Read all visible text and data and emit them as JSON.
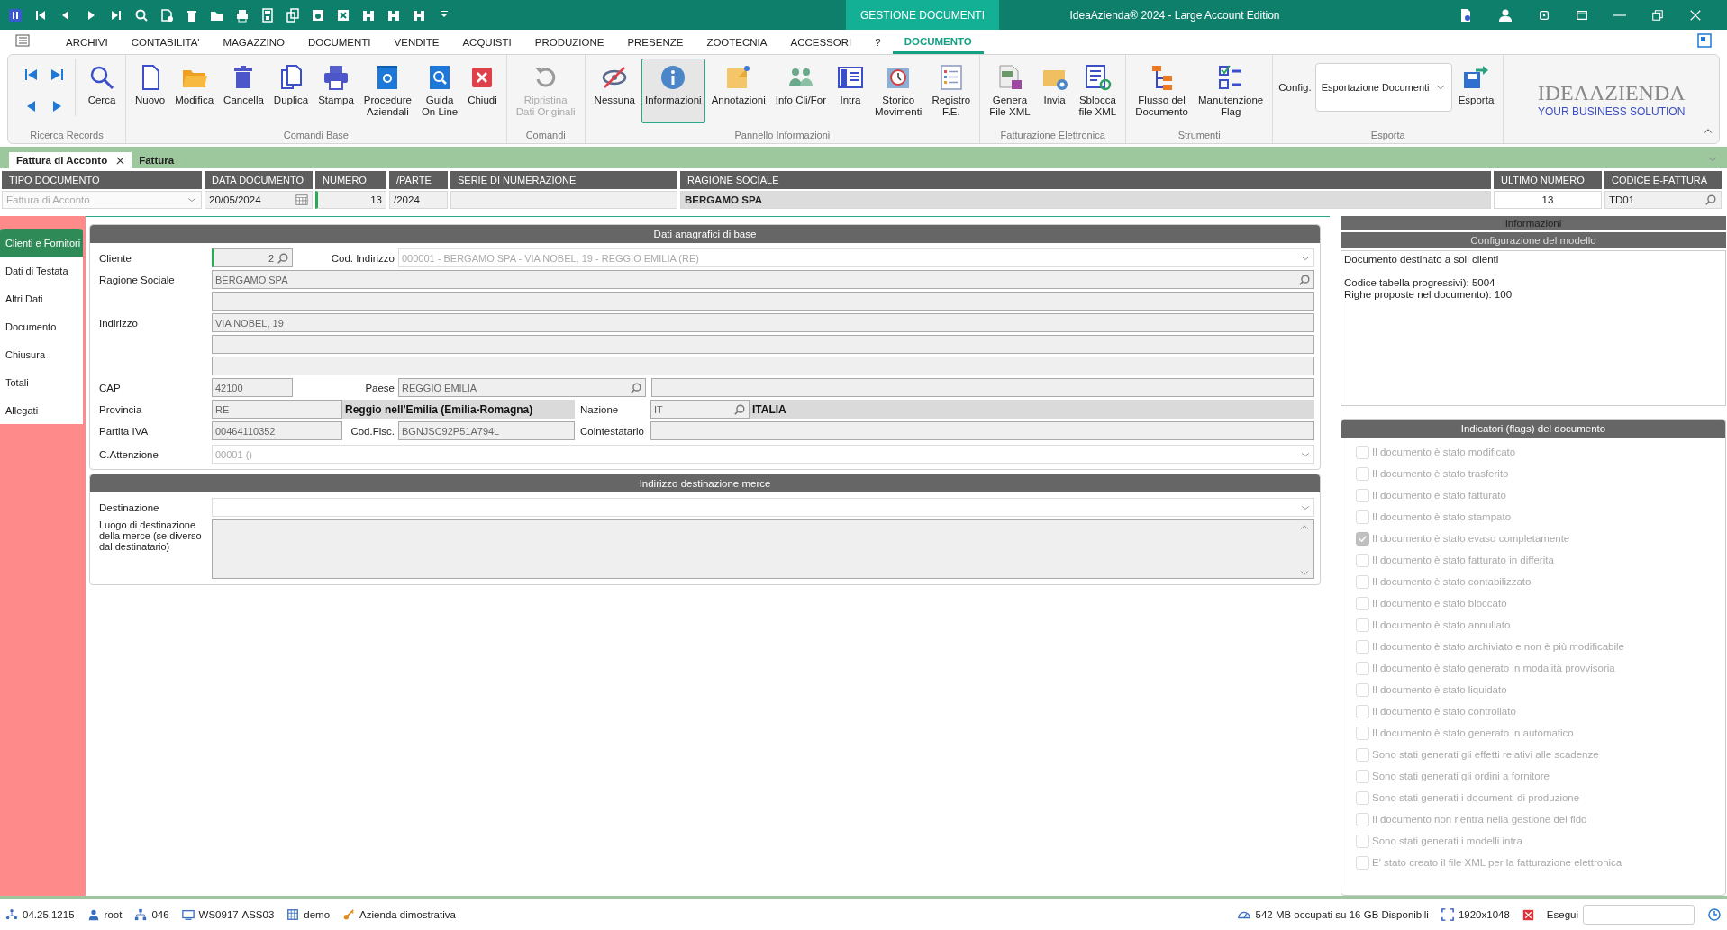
{
  "title_bar": {
    "module": "GESTIONE DOCUMENTI",
    "title": "IdeaAzienda® 2024 - Large Account Edition"
  },
  "menu": [
    {
      "label": "ARCHIVI",
      "selected": false
    },
    {
      "label": "CONTABILITA'",
      "selected": false
    },
    {
      "label": "MAGAZZINO",
      "selected": false
    },
    {
      "label": "DOCUMENTI",
      "selected": false
    },
    {
      "label": "VENDITE",
      "selected": false
    },
    {
      "label": "ACQUISTI",
      "selected": false
    },
    {
      "label": "PRODUZIONE",
      "selected": false
    },
    {
      "label": "PRESENZE",
      "selected": false
    },
    {
      "label": "ZOOTECNIA",
      "selected": false
    },
    {
      "label": "ACCESSORI",
      "selected": false
    },
    {
      "label": "?",
      "selected": false
    },
    {
      "label": "DOCUMENTO",
      "selected": true
    }
  ],
  "ribbon": {
    "groups": [
      {
        "label": "Ricerca Records",
        "buttons": [
          {
            "label": "Cerca",
            "selected": false,
            "disabled": false
          }
        ]
      },
      {
        "label": "Comandi Base",
        "buttons": [
          {
            "label": "Nuovo",
            "selected": false,
            "disabled": false
          },
          {
            "label": "Modifica",
            "selected": false,
            "disabled": false
          },
          {
            "label": "Cancella",
            "selected": false,
            "disabled": false
          },
          {
            "label": "Duplica",
            "selected": false,
            "disabled": false
          },
          {
            "label": "Stampa",
            "selected": false,
            "disabled": false
          },
          {
            "label": "Procedure\nAziendali",
            "selected": false,
            "disabled": false
          },
          {
            "label": "Guida\nOn Line",
            "selected": false,
            "disabled": false
          },
          {
            "label": "Chiudi",
            "selected": false,
            "disabled": false
          }
        ]
      },
      {
        "label": "Comandi",
        "buttons": [
          {
            "label": "Ripristina\nDati Originali",
            "selected": false,
            "disabled": true
          }
        ]
      },
      {
        "label": "Pannello Informazioni",
        "buttons": [
          {
            "label": "Nessuna",
            "selected": false,
            "disabled": false
          },
          {
            "label": "Informazioni",
            "selected": true,
            "disabled": false
          },
          {
            "label": "Annotazioni",
            "selected": false,
            "disabled": false
          },
          {
            "label": "Info Cli/For",
            "selected": false,
            "disabled": false
          },
          {
            "label": "Intra",
            "selected": false,
            "disabled": false
          },
          {
            "label": "Storico\nMovimenti",
            "selected": false,
            "disabled": false
          },
          {
            "label": "Registro\nF.E.",
            "selected": false,
            "disabled": false
          }
        ]
      },
      {
        "label": "Fatturazione Elettronica",
        "buttons": [
          {
            "label": "Genera\nFile XML",
            "selected": false,
            "disabled": false
          },
          {
            "label": "Invia",
            "selected": false,
            "disabled": false
          },
          {
            "label": "Sblocca\nfile XML",
            "selected": false,
            "disabled": false
          }
        ]
      },
      {
        "label": "Strumenti",
        "buttons": [
          {
            "label": "Flusso del\nDocumento",
            "selected": false,
            "disabled": false
          },
          {
            "label": "Manutenzione\nFlag",
            "selected": false,
            "disabled": false
          }
        ]
      },
      {
        "label": "Esporta",
        "config_label": "Config.",
        "config_value": "Esportazione Documenti",
        "buttons": [
          {
            "label": "Esporta",
            "selected": false,
            "disabled": false
          }
        ]
      }
    ]
  },
  "logo": {
    "name": "IDEAAZIENDA",
    "tagline": "YOUR BUSINESS SOLUTION"
  },
  "document_tabs": [
    {
      "label": "Fattura di Acconto",
      "selected": true
    },
    {
      "label": "Fattura",
      "selected": false
    }
  ],
  "header": [
    {
      "kind": "dropdown",
      "label": "TIPO DOCUMENTO",
      "value": "Fattura di Acconto"
    },
    {
      "kind": "date",
      "label": "DATA DOCUMENTO",
      "value": "20/05/2024"
    },
    {
      "kind": "number",
      "label": "NUMERO",
      "value": "13"
    },
    {
      "kind": "text",
      "label": "/PARTE",
      "value": "/2024"
    },
    {
      "kind": "text",
      "label": "SERIE DI NUMERAZIONE"
    },
    {
      "kind": "bold",
      "label": "RAGIONE SOCIALE",
      "value": "BERGAMO SPA"
    },
    {
      "kind": "center",
      "label": "ULTIMO NUMERO",
      "value": "13"
    },
    {
      "kind": "search",
      "label": "CODICE E-FATTURA",
      "value": "TD01"
    }
  ],
  "sidebar": [
    {
      "label": "Clienti e Fornitori",
      "selected": true
    },
    {
      "label": "Dati di Testata",
      "selected": false
    },
    {
      "label": "Altri Dati",
      "selected": false
    },
    {
      "label": "Documento",
      "selected": false
    },
    {
      "label": "Chiusura",
      "selected": false
    },
    {
      "label": "Totali",
      "selected": false
    },
    {
      "label": "Allegati",
      "selected": false
    }
  ],
  "anagrafica": {
    "title": "Dati anagrafici di base",
    "cliente": {
      "label": "Cliente",
      "value": "2"
    },
    "cod_indirizzo": {
      "label": "Cod. Indirizzo",
      "value": "000001 - BERGAMO SPA - VIA NOBEL, 19 - REGGIO EMILIA (RE)"
    },
    "ragione_sociale": {
      "label": "Ragione Sociale",
      "value": "BERGAMO SPA"
    },
    "indirizzo": {
      "label": "Indirizzo",
      "value": "VIA NOBEL, 19"
    },
    "cap": {
      "label": "CAP",
      "value": "42100"
    },
    "paese": {
      "label": "Paese",
      "value": "REGGIO EMILIA"
    },
    "provincia": {
      "label": "Provincia",
      "value": "RE",
      "name": "Reggio nell'Emilia (Emilia-Romagna)"
    },
    "nazione": {
      "label": "Nazione",
      "value": "IT",
      "name": "ITALIA"
    },
    "partita_iva": {
      "label": "Partita IVA",
      "value": "00464110352"
    },
    "cod_fisc": {
      "label": "Cod.Fisc.",
      "value": "BGNJSC92P51A794L"
    },
    "cointestatario": {
      "label": "Cointestatario"
    },
    "attenzione": {
      "label": "C.Attenzione",
      "value": "00001 ()"
    }
  },
  "destinazione": {
    "title": "Indirizzo destinazione merce",
    "destinazione_label": "Destinazione",
    "luogo_label": "Luogo di destinazione della merce (se diverso dal destinatario)"
  },
  "info": {
    "title": "Informazioni",
    "subtitle": "Configurazione del modello",
    "paragraphs": [
      [
        "Documento destinato a soli clienti"
      ],
      [
        "Codice tabella progressivi): 5004",
        "Righe proposte nel documento): 100"
      ]
    ]
  },
  "flags": {
    "title": "Indicatori (flags) del documento",
    "disabled": true,
    "items": [
      {
        "label": "Il documento è stato modificato",
        "checked": false
      },
      {
        "label": "Il documento è stato trasferito",
        "checked": false
      },
      {
        "label": "Il documento è stato fatturato",
        "checked": false
      },
      {
        "label": "Il documento è stato stampato",
        "checked": false
      },
      {
        "label": "Il documento è stato evaso completamente",
        "checked": true
      },
      {
        "label": "Il documento è stato fatturato in differita",
        "checked": false
      },
      {
        "label": "Il documento è stato contabilizzato",
        "checked": false
      },
      {
        "label": "Il documento è stato bloccato",
        "checked": false
      },
      {
        "label": "Il documento è stato annullato",
        "checked": false
      },
      {
        "label": "Il documento è stato archiviato e non è più modificabile",
        "checked": false
      },
      {
        "label": "Il documento è stato generato in modalità provvisoria",
        "checked": false
      },
      {
        "label": "Il documento è stato liquidato",
        "checked": false
      },
      {
        "label": "Il documento è stato controllato",
        "checked": false
      },
      {
        "label": "Il documento è stato generato in automatico",
        "checked": false
      },
      {
        "label": "Sono stati generati gli effetti relativi alle scadenze",
        "checked": false
      },
      {
        "label": "Sono stati generati gli ordini a fornitore",
        "checked": false
      },
      {
        "label": "Sono stati generati i documenti di produzione",
        "checked": false
      },
      {
        "label": "Il documento non rientra nella gestione del fido",
        "checked": false
      },
      {
        "label": "Sono stati generati i modelli intra",
        "checked": false
      },
      {
        "label": "E' stato creato il file XML per la fatturazione elettronica",
        "checked": false
      }
    ]
  },
  "status_bar": {
    "items": [
      "04.25.1215",
      "root",
      "046",
      "WS0917-ASS03",
      "demo",
      "Azienda dimostrativa"
    ],
    "memory": "542 MB occupati su 16 GB Disponibili",
    "resolution": "1920x1048",
    "run_label": "Esegui"
  }
}
